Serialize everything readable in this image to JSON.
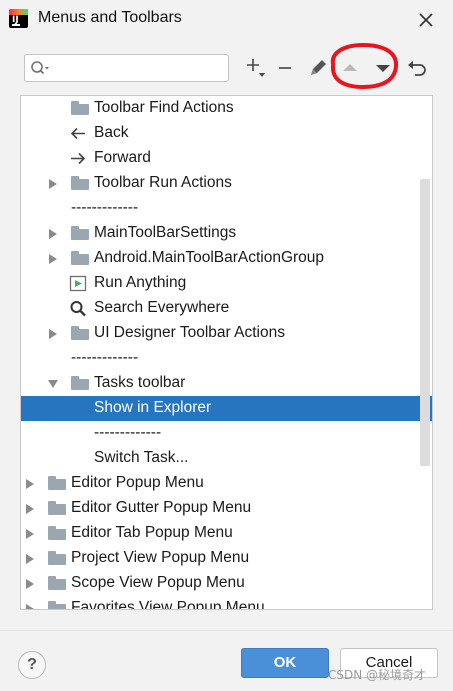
{
  "window": {
    "title": "Menus and Toolbars"
  },
  "search": {
    "value": "",
    "placeholder": ""
  },
  "tree": [
    {
      "label": "Toolbar Find Actions",
      "icon": "folder-icon",
      "expander": "none",
      "selected": false
    },
    {
      "label": "Back",
      "icon": "back-arrow-icon",
      "expander": "none",
      "selected": false
    },
    {
      "label": "Forward",
      "icon": "forward-arrow-icon",
      "expander": "none",
      "selected": false
    },
    {
      "label": "Toolbar Run Actions",
      "icon": "folder-icon",
      "expander": "collapsed",
      "selected": false
    },
    {
      "label": "-------------",
      "icon": "none",
      "expander": "none",
      "selected": false
    },
    {
      "label": "MainToolBarSettings",
      "icon": "folder-icon",
      "expander": "collapsed",
      "selected": false
    },
    {
      "label": "Android.MainToolBarActionGroup",
      "icon": "folder-icon",
      "expander": "collapsed",
      "selected": false
    },
    {
      "label": "Run Anything",
      "icon": "run-anything-icon",
      "expander": "none",
      "selected": false
    },
    {
      "label": "Search Everywhere",
      "icon": "search-icon",
      "expander": "none",
      "selected": false
    },
    {
      "label": "UI Designer Toolbar Actions",
      "icon": "folder-icon",
      "expander": "collapsed",
      "selected": false
    },
    {
      "label": "-------------",
      "icon": "none",
      "expander": "none",
      "selected": false
    },
    {
      "label": "Tasks toolbar",
      "icon": "folder-icon",
      "expander": "expanded",
      "selected": false
    },
    {
      "label": "Show in Explorer",
      "icon": "none",
      "expander": "none",
      "selected": true
    },
    {
      "label": "-------------",
      "icon": "none",
      "expander": "none",
      "selected": false
    },
    {
      "label": "Switch Task...",
      "icon": "none",
      "expander": "none",
      "selected": false
    },
    {
      "label": "Editor Popup Menu",
      "icon": "folder-icon",
      "expander": "collapsed",
      "selected": false
    },
    {
      "label": "Editor Gutter Popup Menu",
      "icon": "folder-icon",
      "expander": "collapsed",
      "selected": false
    },
    {
      "label": "Editor Tab Popup Menu",
      "icon": "folder-icon",
      "expander": "collapsed",
      "selected": false
    },
    {
      "label": "Project View Popup Menu",
      "icon": "folder-icon",
      "expander": "collapsed",
      "selected": false
    },
    {
      "label": "Scope View Popup Menu",
      "icon": "folder-icon",
      "expander": "collapsed",
      "selected": false
    },
    {
      "label": "Favorites View Popup Menu",
      "icon": "folder-icon",
      "expander": "collapsed",
      "selected": false
    }
  ],
  "footer": {
    "help": "?",
    "ok": "OK",
    "cancel": "Cancel"
  },
  "watermark": "CSDN @秘境奇才",
  "colors": {
    "selection": "#2675bf",
    "ok_button": "#4a90d9",
    "annotation": "#e8141e"
  }
}
